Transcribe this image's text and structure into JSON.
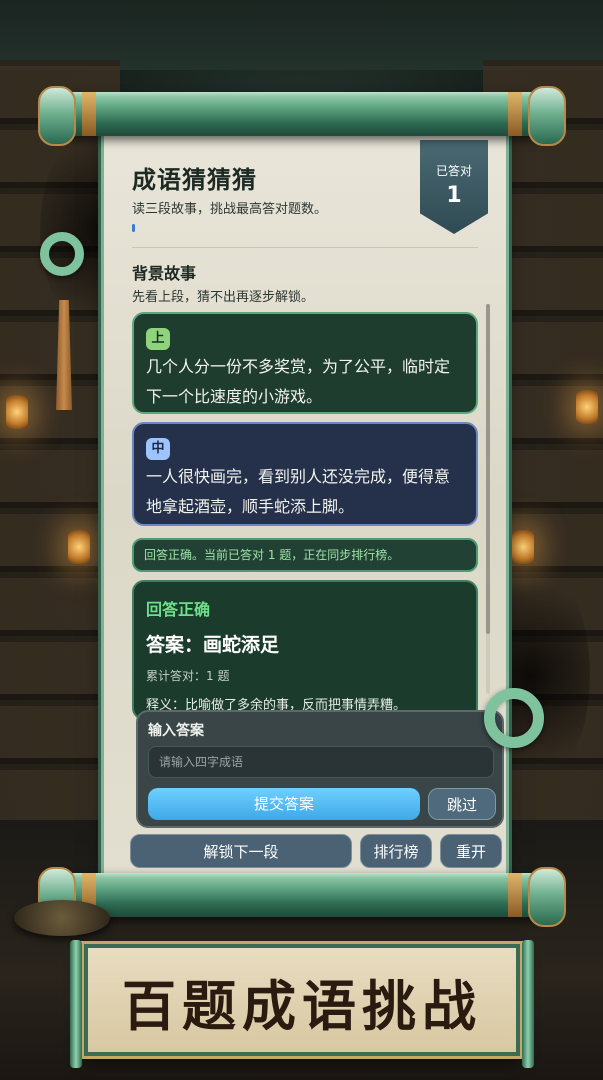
{
  "game": {
    "title": "成语猜猜猜",
    "subtitle": "读三段故事，挑战最高答对题数。",
    "progress": 0.01
  },
  "score_badge": {
    "label": "已答对",
    "value": "1"
  },
  "story_section": {
    "title": "背景故事",
    "hint": "先看上段，猜不出再逐步解锁。",
    "parts": [
      {
        "tag": "上",
        "text": "几个人分一份不多奖赏，为了公平，临时定下一个比速度的小游戏。"
      },
      {
        "tag": "中",
        "text": "一人很快画完，看到别人还没完成，便得意地拿起酒壶，顺手蛇添上脚。"
      }
    ]
  },
  "status_message": "回答正确。当前已答对 1 题，正在同步排行榜。",
  "result": {
    "heading": "回答正确",
    "answer": "答案：画蛇添足",
    "count": "累计答对：1 题",
    "meaning": "释义：比喻做了多余的事，反而把事情弄糟。"
  },
  "input_panel": {
    "label": "输入答案",
    "placeholder": "请输入四字成语",
    "value": "",
    "submit_label": "提交答案",
    "skip_label": "跳过"
  },
  "actions": {
    "unlock_label": "解锁下一段",
    "rank_label": "排行榜",
    "reset_label": "重开"
  },
  "banner": {
    "text": "百题成语挑战"
  },
  "colors": {
    "accent_blue": "#3ea8e8",
    "correct_green": "#6fe08a",
    "card_green": "#1f3d2f",
    "card_navy": "#25304a",
    "jade": "#7fc39e"
  },
  "icons": [
    "jade-ring-icon",
    "scroll-rod-icon"
  ]
}
